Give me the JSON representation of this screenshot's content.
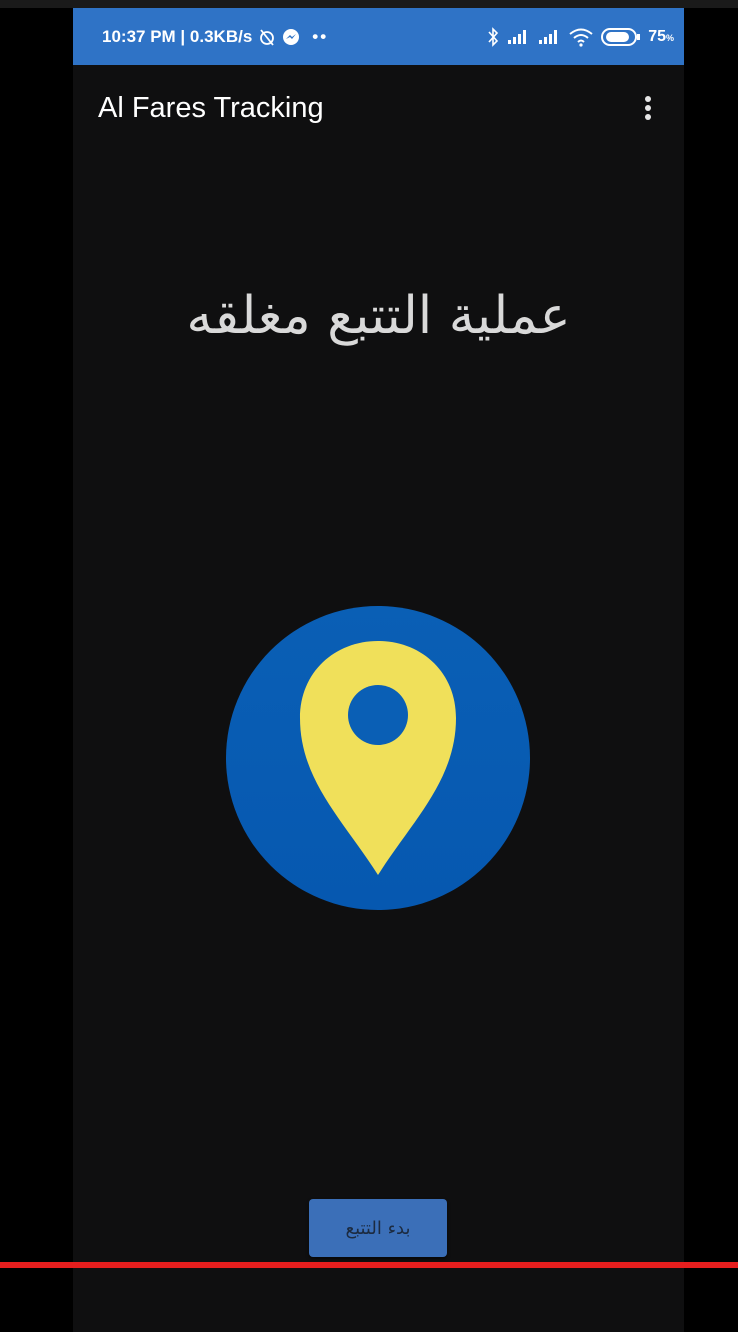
{
  "status_bar": {
    "time_info": "10:37 PM | 0.3KB/s",
    "battery": "75",
    "battery_suffix": "%",
    "icons": [
      "alarm-off-icon",
      "messenger-icon",
      "more-notifications-icon",
      "bluetooth-icon",
      "signal-icon",
      "signal-icon",
      "wifi-icon",
      "battery-icon"
    ]
  },
  "app_bar": {
    "title": "Al Fares Tracking",
    "menu_icon": "more-vert-icon"
  },
  "main": {
    "tracking_status": "عملية التتبع مغلقه",
    "logo_icon": "location-pin-icon"
  },
  "start_button": {
    "label": "بدء التتبع"
  },
  "colors": {
    "status_bar": "#2f73c6",
    "background": "#0f0f10",
    "logo_circle": "#0a5fb5",
    "pin": "#f0e05a",
    "button": "#3b6fb8",
    "red_line": "#e61e1e"
  }
}
